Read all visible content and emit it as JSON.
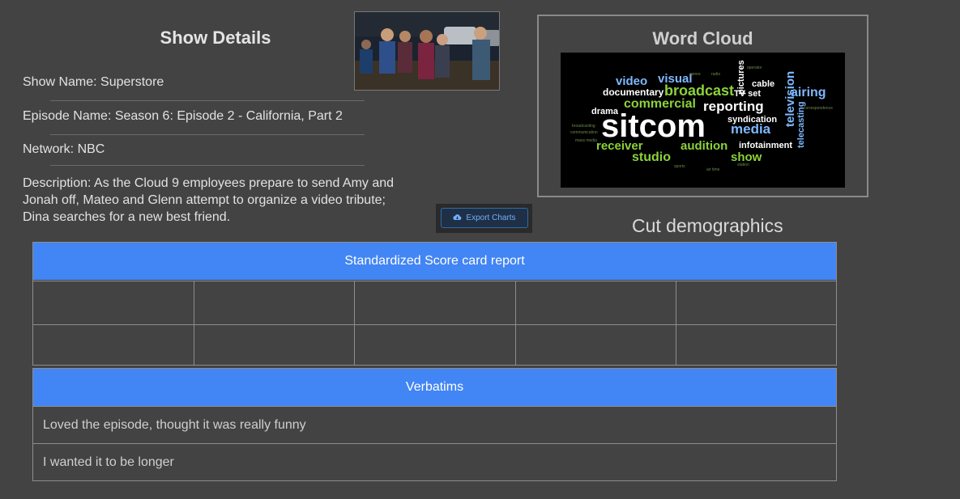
{
  "show_details": {
    "title": "Show Details",
    "show_name": "Show Name: Superstore",
    "episode_name": "Episode Name: Season 6: Episode 2 - California, Part 2",
    "network": "Network: NBC",
    "description": "Description: As the Cloud 9 employees prepare to send Amy and Jonah off, Mateo and Glenn attempt to organize a video tribute; Dina searches for a new best friend."
  },
  "word_cloud": {
    "title": "Word Cloud",
    "words": [
      "sitcom",
      "broadcast",
      "commercial",
      "reporting",
      "media",
      "television",
      "studio",
      "show",
      "audition",
      "receiver",
      "documentary",
      "video",
      "visual",
      "airing",
      "syndication",
      "infotainment",
      "drama",
      "cable",
      "TV set",
      "pictures",
      "telecasting"
    ]
  },
  "export_button": {
    "label": "Export Charts",
    "icon": "cloud-download-icon"
  },
  "cut_demographics": {
    "title": "Cut demographics"
  },
  "scorecard": {
    "title": "Standardized Score card report",
    "rows": [
      [
        "",
        "",
        "",
        "",
        ""
      ],
      [
        "",
        "",
        "",
        "",
        ""
      ]
    ]
  },
  "verbatims": {
    "title": "Verbatims",
    "items": [
      "Loved the episode, thought it was really funny",
      "I wanted it to be longer"
    ]
  },
  "colors": {
    "background": "#434343",
    "header_blue": "#4285f4",
    "border": "#8d8d8d"
  }
}
